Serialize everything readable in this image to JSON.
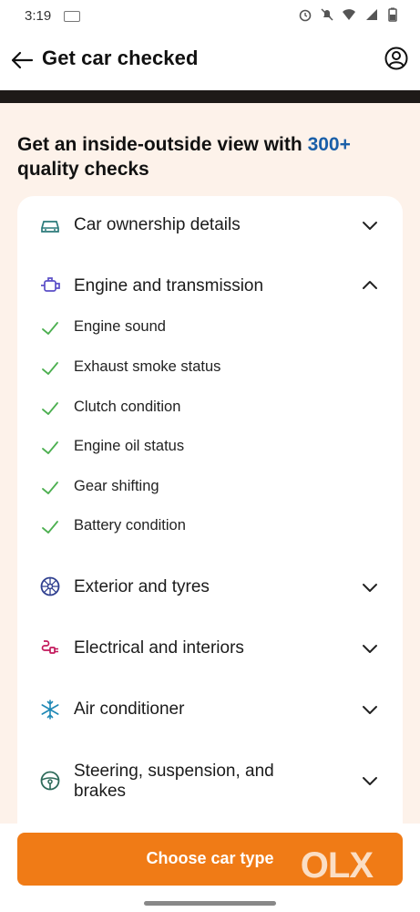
{
  "status_bar": {
    "time": "3:19"
  },
  "header": {
    "title": "Get car checked"
  },
  "headline": {
    "prefix": "Get an inside-outside view with ",
    "accent": "300+",
    "suffix": " quality checks"
  },
  "sections": [
    {
      "title": "Car ownership details",
      "icon": "car-icon",
      "expanded": false
    },
    {
      "title": "Engine and transmission",
      "icon": "engine-icon",
      "expanded": true,
      "items": [
        "Engine sound",
        "Exhaust smoke status",
        "Clutch condition",
        "Engine oil status",
        "Gear shifting",
        "Battery condition"
      ]
    },
    {
      "title": "Exterior and tyres",
      "icon": "tyre-icon",
      "expanded": false
    },
    {
      "title": "Electrical and interiors",
      "icon": "plug-icon",
      "expanded": false
    },
    {
      "title": "Air conditioner",
      "icon": "snowflake-icon",
      "expanded": false
    },
    {
      "title": "Steering, suspension, and brakes",
      "icon": "steering-wheel-icon",
      "expanded": false
    }
  ],
  "cta": {
    "label": "Choose car type",
    "watermark": "OLX"
  },
  "colors": {
    "accent": "#1a5fa8",
    "cta": "#f07b16",
    "check": "#4caf50",
    "background": "#fdf2ea"
  }
}
